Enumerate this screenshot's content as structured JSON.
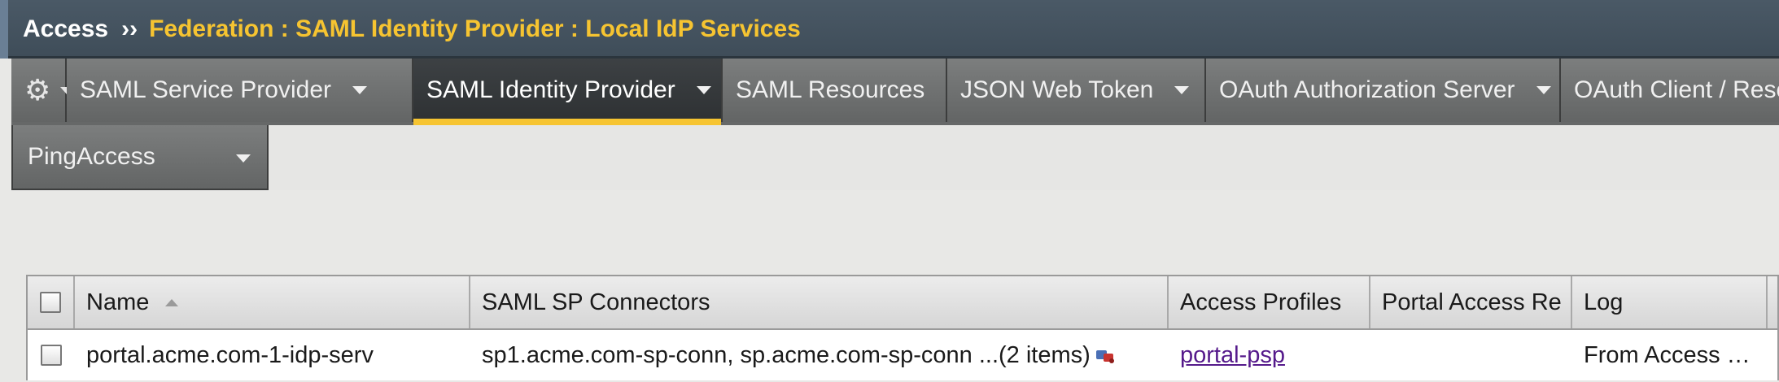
{
  "breadcrumb": {
    "root": "Access",
    "separator": "››",
    "path": "Federation : SAML Identity Provider : Local IdP Services"
  },
  "tabs": [
    {
      "label": "SAML Service Provider",
      "has_menu": true,
      "active": false
    },
    {
      "label": "SAML Identity Provider",
      "has_menu": true,
      "active": true
    },
    {
      "label": "SAML Resources",
      "has_menu": false,
      "active": false
    },
    {
      "label": "JSON Web Token",
      "has_menu": true,
      "active": false
    },
    {
      "label": "OAuth Authorization Server",
      "has_menu": true,
      "active": false
    },
    {
      "label": "OAuth Client / Reso",
      "has_menu": false,
      "active": false
    }
  ],
  "tab_row2": {
    "label": "PingAccess",
    "has_menu": true
  },
  "table": {
    "columns": [
      "Name",
      "SAML SP Connectors",
      "Access Profiles",
      "Portal Access Re",
      "Log"
    ],
    "sort": {
      "column": "Name",
      "direction": "ascending"
    },
    "rows": [
      {
        "name": "portal.acme.com-1-idp-serv",
        "connectors": "sp1.acme.com-sp-conn, sp.acme.com-sp-conn ...(2 items)",
        "access_profile": "portal-psp",
        "portal_access": "",
        "log": "From Access …"
      }
    ]
  },
  "colors": {
    "accent": "#f6c431",
    "header_bg": "#4a5966",
    "tab_bg": "#707272",
    "link": "#551a8b"
  },
  "icons": {
    "settings": "gear-icon",
    "menu": "chevron-down-icon",
    "sort": "sort-ascending-icon",
    "connector": "connector-icon"
  }
}
